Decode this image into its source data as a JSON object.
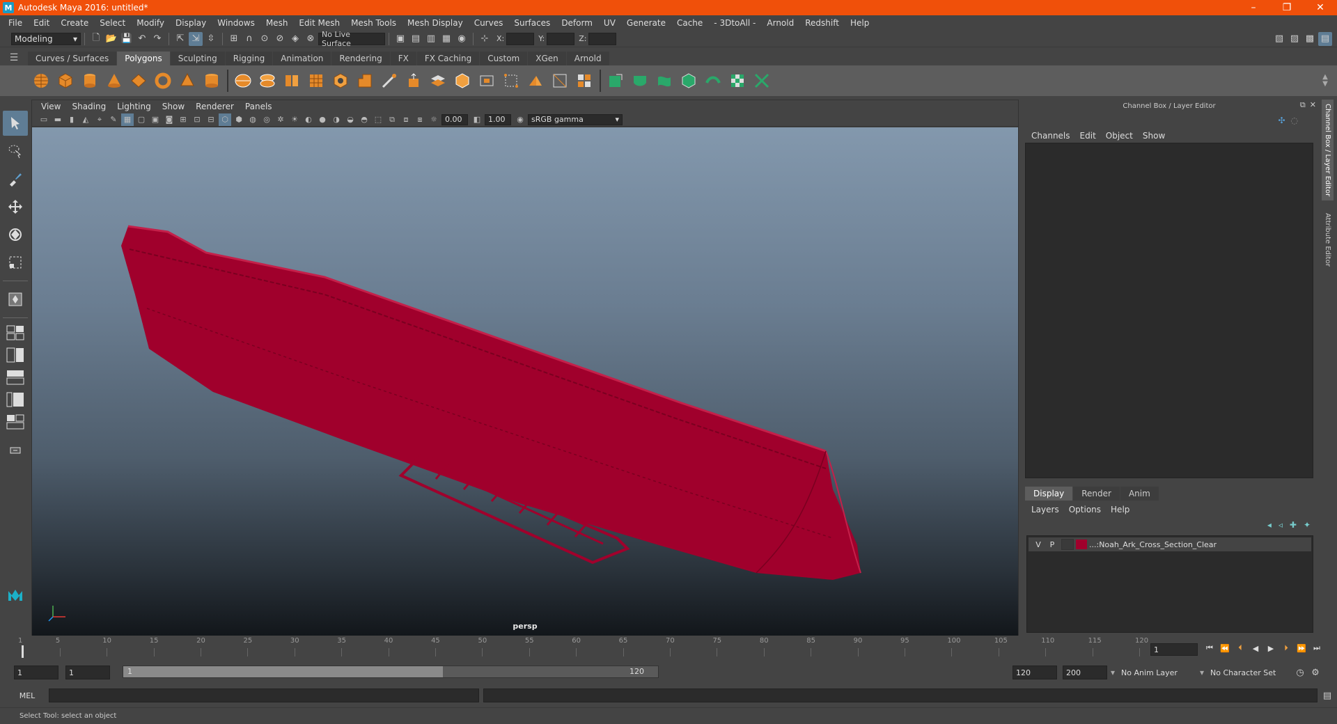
{
  "titlebar": {
    "title": "Autodesk Maya 2016: untitled*",
    "minimize": "–",
    "restore": "❐",
    "close": "✕"
  },
  "menubar": [
    "File",
    "Edit",
    "Create",
    "Select",
    "Modify",
    "Display",
    "Windows",
    "Mesh",
    "Edit Mesh",
    "Mesh Tools",
    "Mesh Display",
    "Curves",
    "Surfaces",
    "Deform",
    "UV",
    "Generate",
    "Cache",
    "- 3DtoAll -",
    "Arnold",
    "Redshift",
    "Help"
  ],
  "statusline": {
    "mode": "Modeling",
    "live_surface": "No Live Surface",
    "x_label": "X:",
    "y_label": "Y:",
    "z_label": "Z:"
  },
  "shelf": {
    "tabs": [
      "Curves / Surfaces",
      "Polygons",
      "Sculpting",
      "Rigging",
      "Animation",
      "Rendering",
      "FX",
      "FX Caching",
      "Custom",
      "XGen",
      "Arnold"
    ],
    "active_tab": "Polygons"
  },
  "viewport": {
    "menus": [
      "View",
      "Shading",
      "Lighting",
      "Show",
      "Renderer",
      "Panels"
    ],
    "exposure": "0.00",
    "gamma": "1.00",
    "color_space": "sRGB gamma",
    "camera_label": "persp",
    "wire_color": "#a0002c"
  },
  "channelbox": {
    "header": "Channel Box / Layer Editor",
    "menus": [
      "Channels",
      "Edit",
      "Object",
      "Show"
    ],
    "layer_tabs": [
      "Display",
      "Render",
      "Anim"
    ],
    "layer_menus": [
      "Layers",
      "Options",
      "Help"
    ],
    "layer": {
      "v": "V",
      "p": "P",
      "name": "...:Noah_Ark_Cross_Section_Clear",
      "color": "#a0002c"
    }
  },
  "side_tabs": [
    "Channel Box / Layer Editor",
    "Attribute Editor"
  ],
  "timeslider": {
    "ticks": [
      "1",
      "5",
      "10",
      "15",
      "20",
      "25",
      "30",
      "35",
      "40",
      "45",
      "50",
      "55",
      "60",
      "65",
      "70",
      "75",
      "80",
      "85",
      "90",
      "95",
      "100",
      "105",
      "110",
      "115",
      "120"
    ],
    "current_frame": "1"
  },
  "range": {
    "start_time": "1",
    "playback_start": "1",
    "range_start": "1",
    "range_end": "120",
    "playback_end": "120",
    "end_time": "200",
    "anim_layer": "No Anim Layer",
    "character_set": "No Character Set"
  },
  "cmdline": {
    "label": "MEL"
  },
  "helpline": {
    "text": "Select Tool: select an object"
  }
}
